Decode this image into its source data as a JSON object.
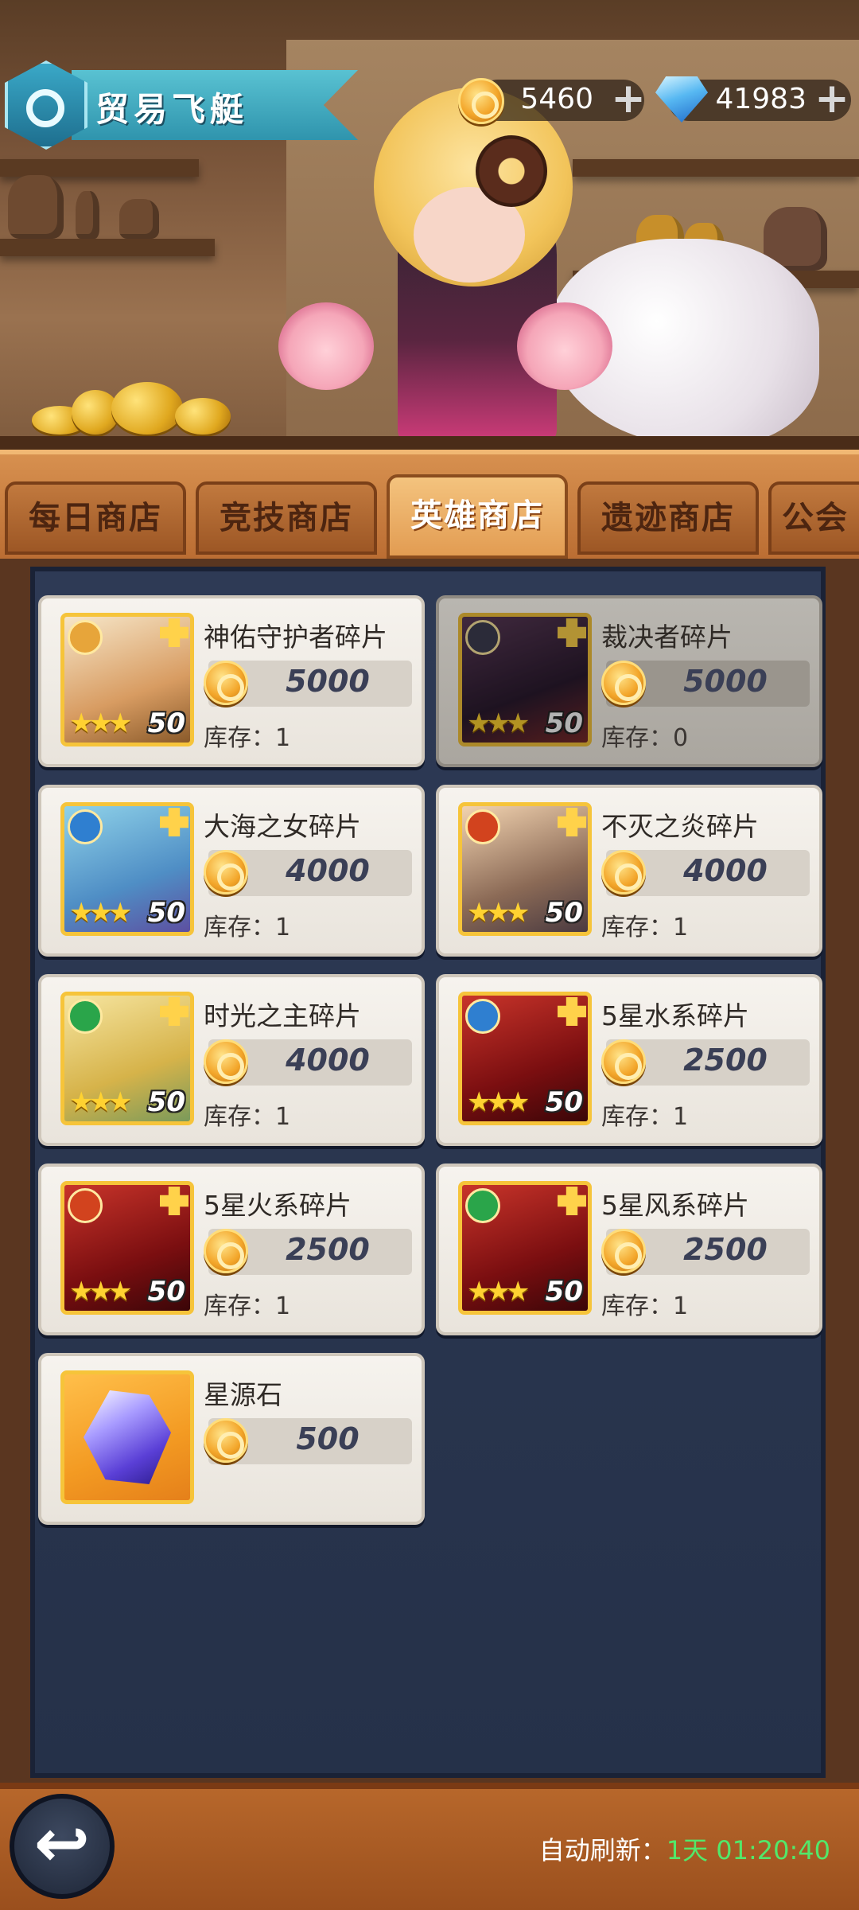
{
  "header": {
    "title": "贸易飞艇"
  },
  "currency": {
    "coins": "5460",
    "gems": "41983"
  },
  "tabs": [
    {
      "label": "每日商店",
      "active": false
    },
    {
      "label": "竞技商店",
      "active": false
    },
    {
      "label": "英雄商店",
      "active": true
    },
    {
      "label": "遗迹商店",
      "active": false
    },
    {
      "label": "公会",
      "active": false
    }
  ],
  "items": [
    {
      "name": "神佑守护者碎片",
      "price": "5000",
      "stock_label": "库存：",
      "stock": "1",
      "stars": "★★★",
      "level": "50",
      "element": "light-icon",
      "sold_out": false
    },
    {
      "name": "裁决者碎片",
      "price": "5000",
      "stock_label": "库存：",
      "stock": "0",
      "stars": "★★★",
      "level": "50",
      "element": "dark-icon",
      "sold_out": true
    },
    {
      "name": "大海之女碎片",
      "price": "4000",
      "stock_label": "库存：",
      "stock": "1",
      "stars": "★★★",
      "level": "50",
      "element": "water-icon",
      "sold_out": false
    },
    {
      "name": "不灭之炎碎片",
      "price": "4000",
      "stock_label": "库存：",
      "stock": "1",
      "stars": "★★★",
      "level": "50",
      "element": "fire-icon",
      "sold_out": false
    },
    {
      "name": "时光之主碎片",
      "price": "4000",
      "stock_label": "库存：",
      "stock": "1",
      "stars": "★★★",
      "level": "50",
      "element": "wind-icon",
      "sold_out": false
    },
    {
      "name": "5星水系碎片",
      "price": "2500",
      "stock_label": "库存：",
      "stock": "1",
      "stars": "★★★",
      "level": "50",
      "element": "water-icon",
      "sold_out": false
    },
    {
      "name": "5星火系碎片",
      "price": "2500",
      "stock_label": "库存：",
      "stock": "1",
      "stars": "★★★",
      "level": "50",
      "element": "fire-icon",
      "sold_out": false
    },
    {
      "name": "5星风系碎片",
      "price": "2500",
      "stock_label": "库存：",
      "stock": "1",
      "stars": "★★★",
      "level": "50",
      "element": "wind-icon",
      "sold_out": false
    },
    {
      "name": "星源石",
      "price": "500",
      "stock_label": "",
      "stock": "",
      "stars": "",
      "level": "",
      "element": "crystal-icon",
      "sold_out": false
    }
  ],
  "footer": {
    "refresh_label": "自动刷新：",
    "refresh_time": "1天 01:20:40"
  },
  "colors": {
    "accent_green": "#52e86a",
    "banner": "#3aa8c7",
    "coin": "#f3a62a"
  }
}
